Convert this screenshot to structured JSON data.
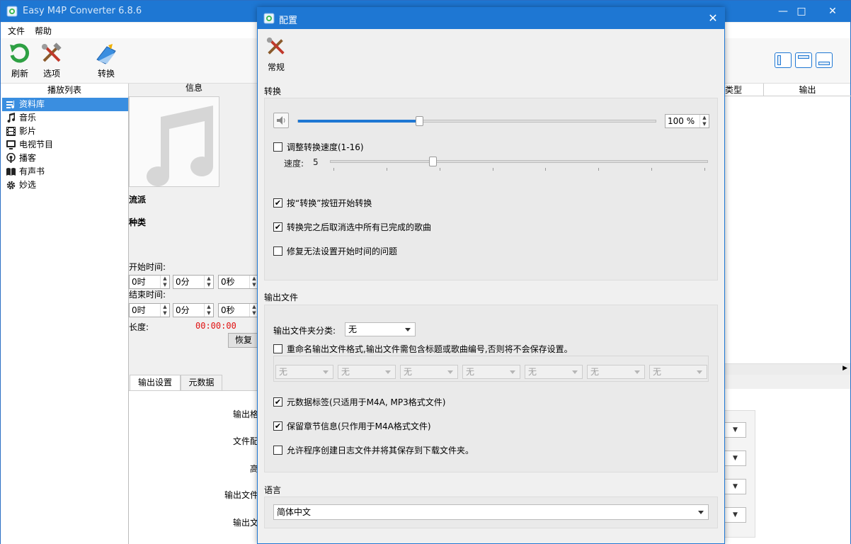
{
  "main_window": {
    "title": "Easy M4P Converter 6.8.6",
    "menu": [
      "文件",
      "帮助"
    ],
    "toolbar": [
      {
        "label": "刷新",
        "icon": "refresh-icon"
      },
      {
        "label": "选项",
        "icon": "tools-icon"
      },
      {
        "label": "转换",
        "icon": "convert-icon"
      }
    ],
    "layout_icons": [
      "layout-left-icon",
      "layout-center-icon",
      "layout-bottom-icon"
    ]
  },
  "left_panel": {
    "header": "播放列表",
    "items": [
      {
        "label": "资料库",
        "icon": "library-icon",
        "selected": true
      },
      {
        "label": "音乐",
        "icon": "music-icon"
      },
      {
        "label": "影片",
        "icon": "film-icon"
      },
      {
        "label": "电视节目",
        "icon": "tv-icon"
      },
      {
        "label": "播客",
        "icon": "podcast-icon"
      },
      {
        "label": "有声书",
        "icon": "audiobook-icon"
      },
      {
        "label": "妙选",
        "icon": "gear-icon"
      }
    ]
  },
  "info_panel": {
    "header": "信息",
    "genre_label": "流派",
    "kind_label": "种类",
    "start_label": "开始时间:",
    "end_label": "结束时间:",
    "start": {
      "h": "0时",
      "m": "0分",
      "s": "0秒"
    },
    "end": {
      "h": "0时",
      "m": "0分",
      "s": "0秒"
    },
    "length_label": "长度:",
    "length_value": "00:00:00",
    "restore_label": "恢复",
    "tabs": [
      "输出设置",
      "元数据"
    ],
    "output_labels": [
      "输出格",
      "文件配",
      "高",
      "输出文件",
      "输出文"
    ]
  },
  "right_panel": {
    "col_type": "类型",
    "col_output": "输出"
  },
  "dialog": {
    "title": "配置",
    "tab_label": "常规",
    "convert_section": "转换",
    "volume_value": "100 %",
    "volume_percent": 0.34,
    "speed_checkbox": "调整转换速度(1-16)",
    "speed_label": "速度:",
    "speed_value": "5",
    "speed_range": [
      1,
      16
    ],
    "opt_convert_button": {
      "label": "按“转换”按钮开始转换",
      "checked": true
    },
    "opt_uncheck_done": {
      "label": "转换完之后取消选中所有已完成的歌曲",
      "checked": true
    },
    "opt_fix_start": {
      "label": "修复无法设置开始时间的问题",
      "checked": false
    },
    "output_section": "输出文件",
    "folder_class_label": "输出文件夹分类:",
    "folder_class_value": "无",
    "rename_label": "重命名输出文件格式,输出文件需包含标题或歌曲编号,否则将不会保存设置。",
    "rename_checked": false,
    "rename_fields": [
      "无",
      "无",
      "无",
      "无",
      "无",
      "无",
      "无"
    ],
    "opt_metadata": {
      "label": "元数据标签(只适用于M4A, MP3格式文件)",
      "checked": true
    },
    "opt_chapters": {
      "label": "保留章节信息(只作用于M4A格式文件)",
      "checked": true
    },
    "opt_log": {
      "label": "允许程序创建日志文件并将其保存到下载文件夹。",
      "checked": false
    },
    "language_section": "语言",
    "language_value": "简体中文"
  },
  "colors": {
    "accent": "#1e77d3",
    "length_red": "#e01010",
    "selection": "#3a8ee0"
  }
}
